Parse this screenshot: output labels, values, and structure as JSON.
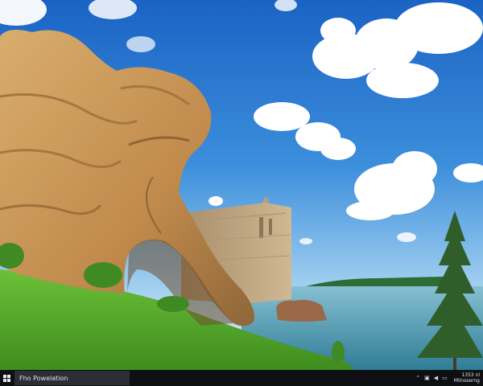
{
  "wallpaper": {
    "subject": "wallpaper",
    "colors": {
      "sky_top": "#1f72cf",
      "sky_horizon": "#bfe0f4",
      "rock": "#c99a5c",
      "rock_shadow": "#8a6236",
      "grass": "#54a52a",
      "water": "#3f8aa6",
      "pine": "#2e5a2a"
    }
  },
  "taskbar": {
    "start_icon": "windows-logo-icon",
    "search_text": "Fho Powelation",
    "tray_icons": [
      "chevron-up-icon",
      "network-icon",
      "volume-icon",
      "battery-icon",
      "notification-icon"
    ],
    "clock_time": "1353 nl",
    "clock_date": "Mlinsserng"
  }
}
